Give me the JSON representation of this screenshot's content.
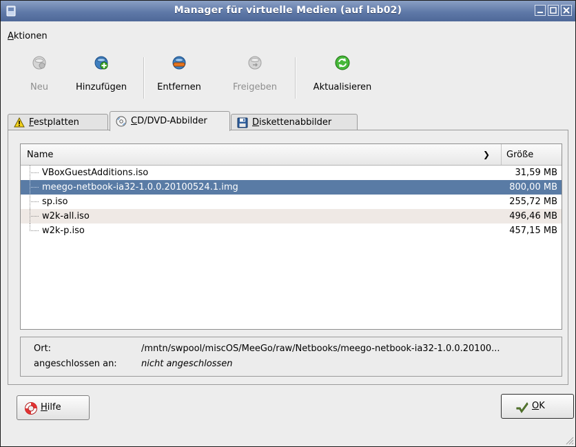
{
  "window": {
    "title": "Manager für virtuelle Medien (auf lab02)"
  },
  "menubar": {
    "items": [
      {
        "accel": "A",
        "rest": "ktionen"
      }
    ]
  },
  "toolbar": {
    "new": "Neu",
    "add": "Hinzufügen",
    "remove": "Entfernen",
    "release": "Freigeben",
    "refresh": "Aktualisieren"
  },
  "tabs": [
    {
      "accel": "F",
      "rest": "estplatten",
      "icon": "warning-icon",
      "active": false
    },
    {
      "accel": "C",
      "rest": "D/DVD-Abbilder",
      "icon": "cd-icon",
      "active": true
    },
    {
      "accel": "D",
      "rest": "iskettenabbilder",
      "icon": "floppy-icon",
      "active": false
    }
  ],
  "list": {
    "columns": {
      "name": "Name",
      "size": "Größe"
    },
    "rows": [
      {
        "name": "VBoxGuestAdditions.iso",
        "size": "31,59 MB",
        "selected": false
      },
      {
        "name": "meego-netbook-ia32-1.0.0.20100524.1.img",
        "size": "800,00 MB",
        "selected": true
      },
      {
        "name": "sp.iso",
        "size": "255,72 MB",
        "selected": false
      },
      {
        "name": "w2k-all.iso",
        "size": "496,46 MB",
        "selected": false
      },
      {
        "name": "w2k-p.iso",
        "size": "457,15 MB",
        "selected": false
      }
    ]
  },
  "info": {
    "location_label": "Ort:",
    "location_value": "/mntn/swpool/miscOS/MeeGo/raw/Netbooks/meego-netbook-ia32-1.0.0.20100...",
    "attached_label": "angeschlossen an:",
    "attached_value": "nicht angeschlossen"
  },
  "buttons": {
    "help": {
      "accel": "H",
      "rest": "ilfe"
    },
    "ok": {
      "accel": "O",
      "rest": "K"
    }
  },
  "colors": {
    "titlebar": "#5f79a8",
    "selection": "#597ba5",
    "alt_row": "#efe9e5"
  }
}
